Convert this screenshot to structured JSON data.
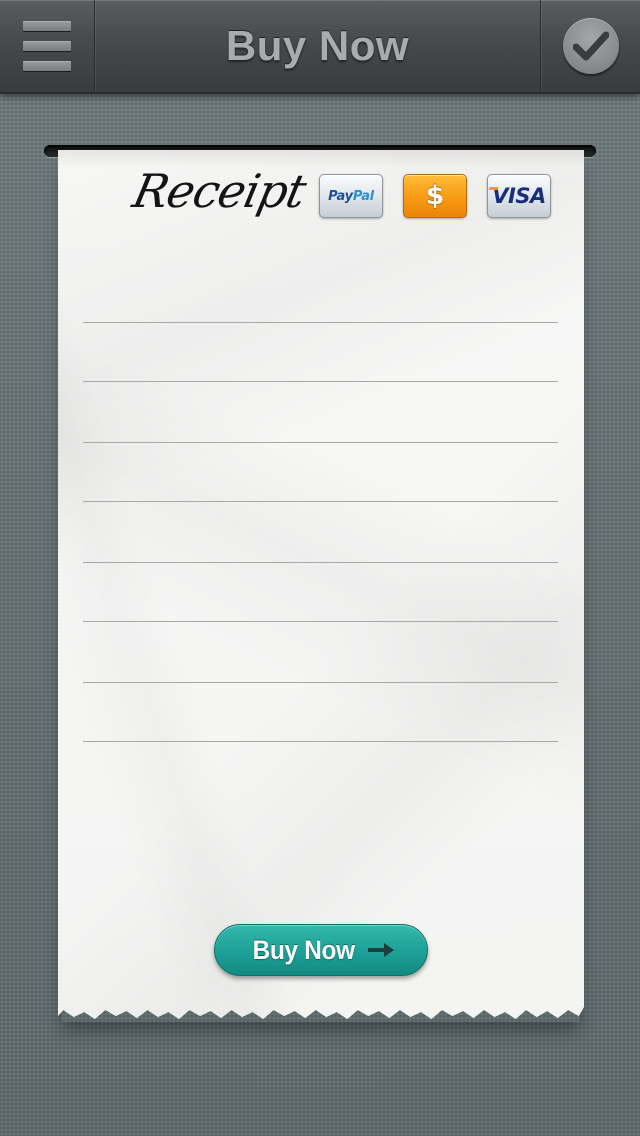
{
  "nav": {
    "title": "Buy Now",
    "menu_icon": "menu-icon",
    "confirm_icon": "check-icon"
  },
  "receipt": {
    "title": "Receipt",
    "payment_methods": [
      {
        "label_a": "Pay",
        "label_b": "Pal",
        "icon": "paypal-icon"
      },
      {
        "label": "$",
        "icon": "cash-icon"
      },
      {
        "label": "VISA",
        "icon": "visa-icon"
      }
    ],
    "line_count": 8,
    "buy_button": {
      "label": "Buy Now",
      "icon": "arrow-right-icon"
    }
  },
  "colors": {
    "background": "#6a7476",
    "nav_bar": "#47494c",
    "paper": "#f5f5f4",
    "button_teal": "#1ea399",
    "cash_orange": "#f79a12",
    "visa_blue": "#1a2e7f",
    "paypal_blue": "#1b4f9e"
  }
}
